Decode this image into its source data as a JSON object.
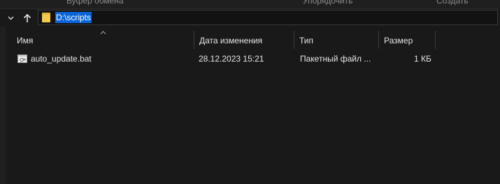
{
  "ribbon": {
    "groups": [
      "Буфер обмена",
      "Упорядочить",
      "Создать"
    ]
  },
  "address_bar": {
    "path": "D:\\scripts",
    "folder_icon": "folder-icon"
  },
  "navigation": {
    "dropdown_icon": "chevron-down-icon",
    "up_icon": "arrow-up-icon"
  },
  "columns": {
    "name": "Имя",
    "date": "Дата изменения",
    "type": "Тип",
    "size": "Размер"
  },
  "files": [
    {
      "name": "auto_update.bat",
      "date": "28.12.2023 15:21",
      "type": "Пакетный файл ...",
      "size": "1 КБ",
      "icon": "batch-file-icon"
    }
  ],
  "colors": {
    "background": "#191919",
    "selection": "#0a64d8",
    "folder": "#f2c94c"
  }
}
